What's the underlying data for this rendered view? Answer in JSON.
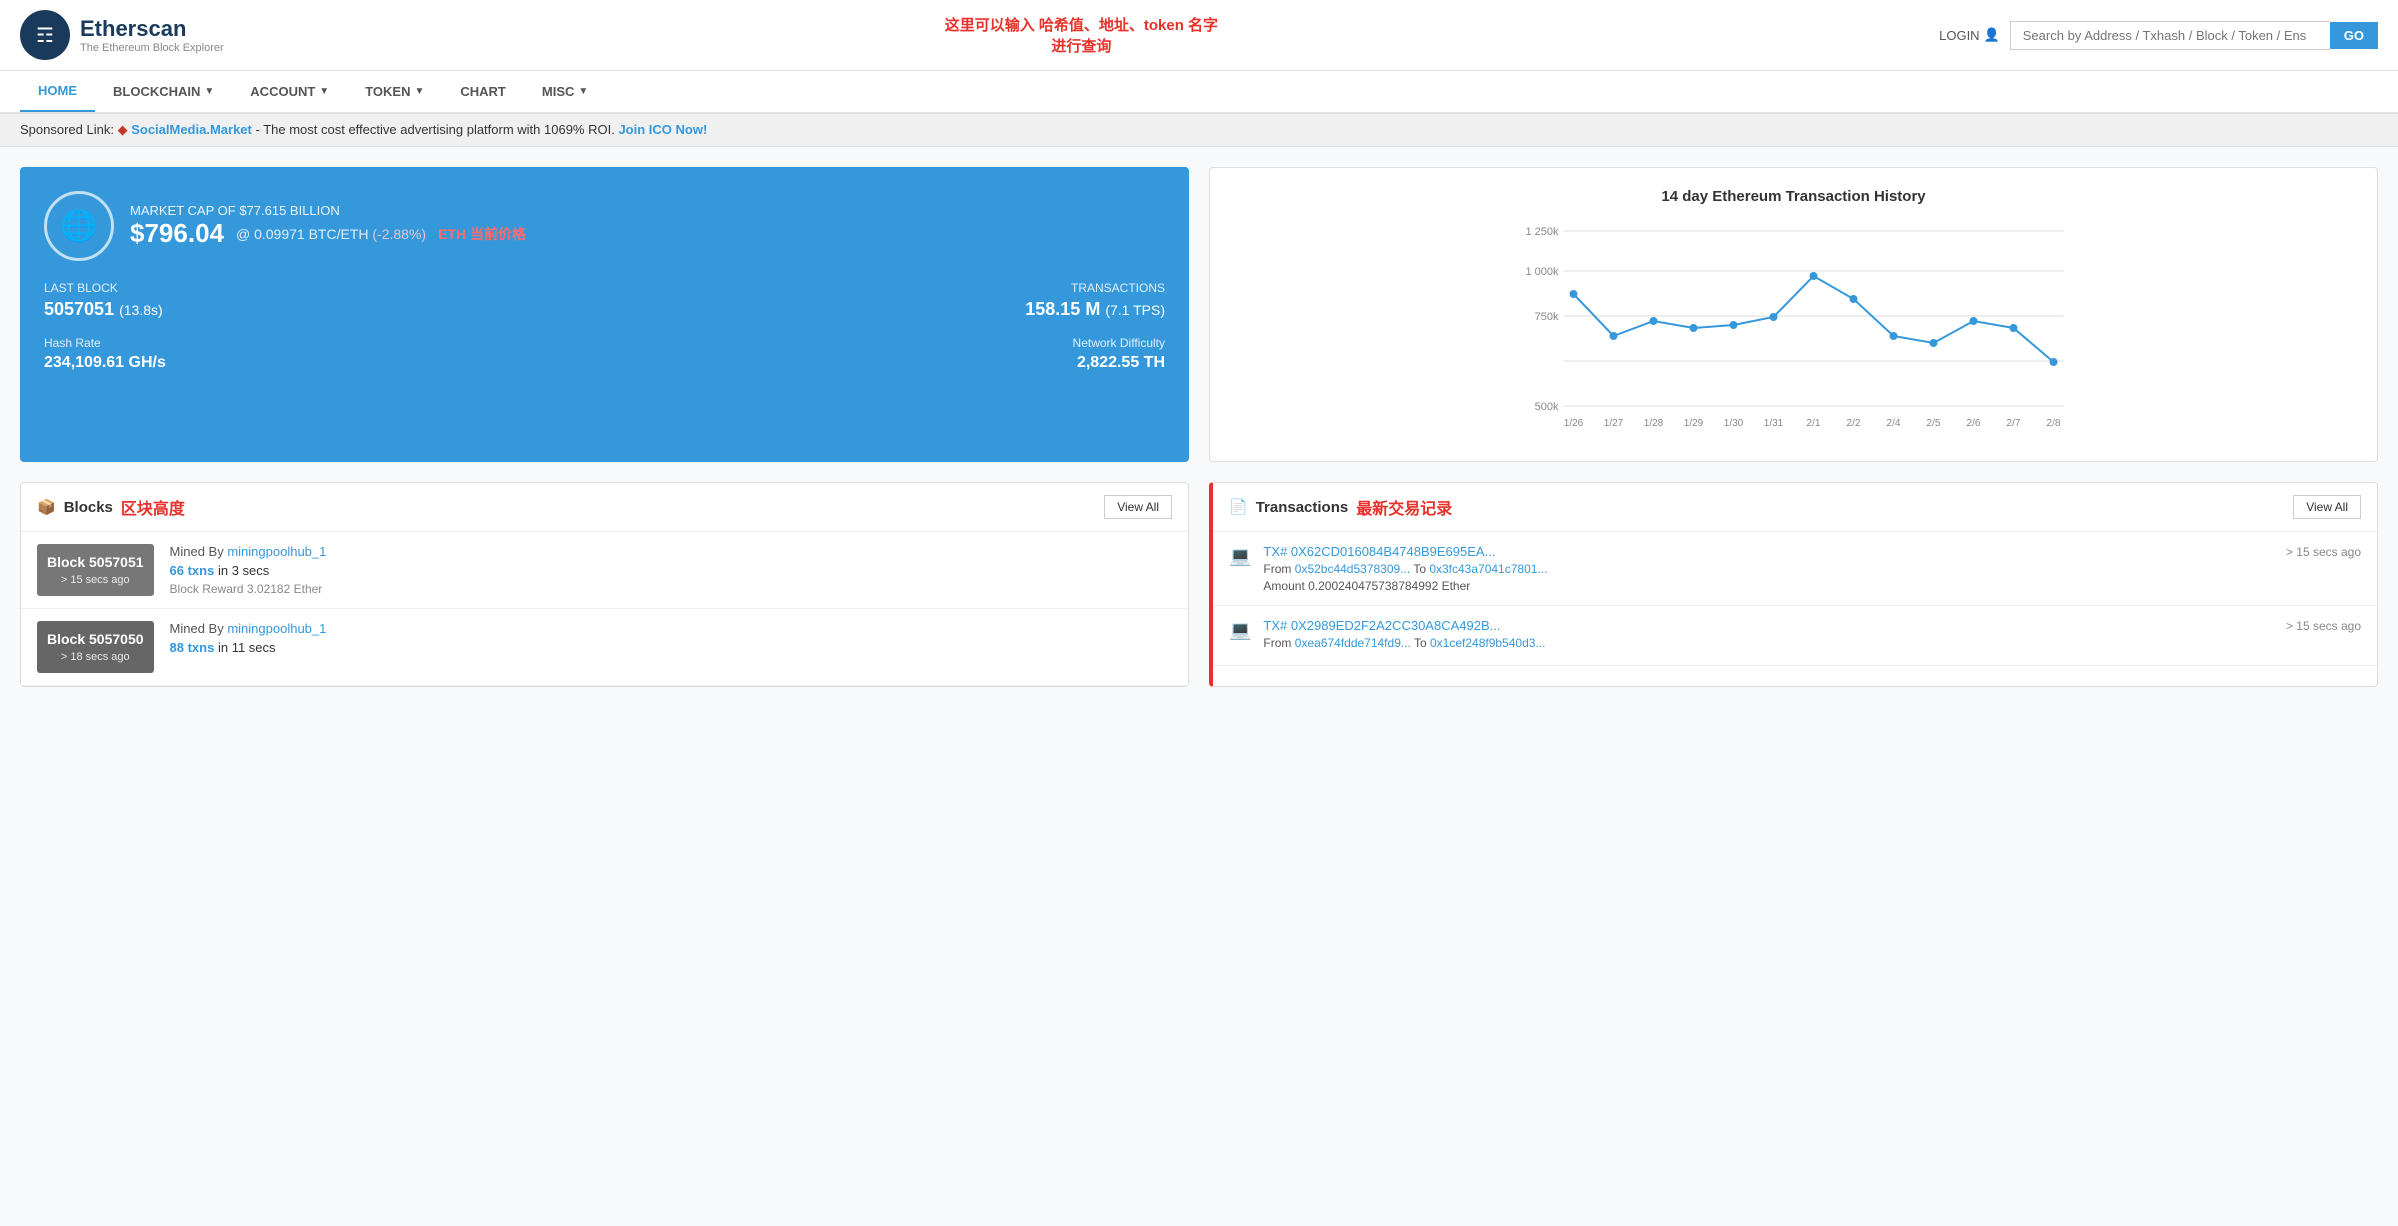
{
  "header": {
    "logo_name": "Etherscan",
    "logo_subtitle": "The Ethereum Block Explorer",
    "annotation_text": "这里可以输入 哈希值、地址、token 名字\n进行查询",
    "login_label": "LOGIN",
    "search_placeholder": "Search by Address / Txhash / Block / Token / Ens",
    "search_btn_label": "GO"
  },
  "nav": {
    "items": [
      {
        "label": "HOME",
        "active": true
      },
      {
        "label": "BLOCKCHAIN",
        "has_chevron": true
      },
      {
        "label": "ACCOUNT",
        "has_chevron": true
      },
      {
        "label": "TOKEN",
        "has_chevron": true
      },
      {
        "label": "CHART"
      },
      {
        "label": "MISC",
        "has_chevron": true
      }
    ]
  },
  "sponsored": {
    "prefix": "Sponsored Link:",
    "brand": "SocialMedia.Market",
    "description": " - The most cost effective advertising platform with 1069% ROI.",
    "cta": "Join ICO Now!"
  },
  "stats": {
    "market_cap_label": "MARKET CAP OF $77.615 BILLION",
    "price": "$796.04",
    "btc_price": "@ 0.09971 BTC/ETH",
    "price_change": "(-2.88%)",
    "eth_annotation": "ETH 当前价格",
    "last_block_label": "LAST BLOCK",
    "last_block_value": "5057051",
    "last_block_sub": "(13.8s)",
    "transactions_label": "TRANSACTIONS",
    "transactions_value": "158.15 M",
    "transactions_sub": "(7.1 TPS)",
    "hash_rate_label": "Hash Rate",
    "hash_rate_value": "234,109.61 GH/s",
    "difficulty_label": "Network Difficulty",
    "difficulty_value": "2,822.55 TH"
  },
  "chart": {
    "title": "14 day Ethereum Transaction History",
    "y_labels": [
      "1 250k",
      "1 000k",
      "750k",
      "500k"
    ],
    "x_labels": [
      "1/26",
      "1/27",
      "1/28",
      "1/29",
      "1/30",
      "1/31",
      "2/1",
      "2/2",
      "2/4",
      "2/5",
      "2/6",
      "2/7",
      "2/8"
    ],
    "data_points": [
      940,
      800,
      860,
      830,
      840,
      870,
      1010,
      920,
      800,
      780,
      860,
      830,
      690
    ]
  },
  "blocks": {
    "title": "Blocks",
    "annotation": "区块高度",
    "view_all": "View All",
    "items": [
      {
        "number": "Block 5057051",
        "time": "> 15 secs ago",
        "mined_by_label": "Mined By",
        "mined_by": "miningpoolhub_1",
        "txns": "66 txns",
        "txns_time": "in 3 secs",
        "reward": "Block Reward 3.02182 Ether"
      },
      {
        "number": "Block 5057050",
        "time": "> 18 secs ago",
        "mined_by_label": "Mined By",
        "mined_by": "miningpoolhub_1",
        "txns": "88 txns",
        "txns_time": "in 11 secs",
        "reward": ""
      }
    ]
  },
  "transactions": {
    "title": "Transactions",
    "annotation": "最新交易记录",
    "view_all": "View All",
    "items": [
      {
        "hash": "TX# 0X62CD016084B4748B9E695EA...",
        "time": "> 15 secs ago",
        "from": "0x52bc44d5378309...",
        "to": "0x3fc43a7041c7801...",
        "amount": "Amount 0.200240475738784992 Ether"
      },
      {
        "hash": "TX# 0X2989ED2F2A2CC30A8CA492B...",
        "time": "> 15 secs ago",
        "from": "0xea674fdde714fd9...",
        "to": "0x1cef248f9b540d3...",
        "amount": ""
      }
    ]
  }
}
